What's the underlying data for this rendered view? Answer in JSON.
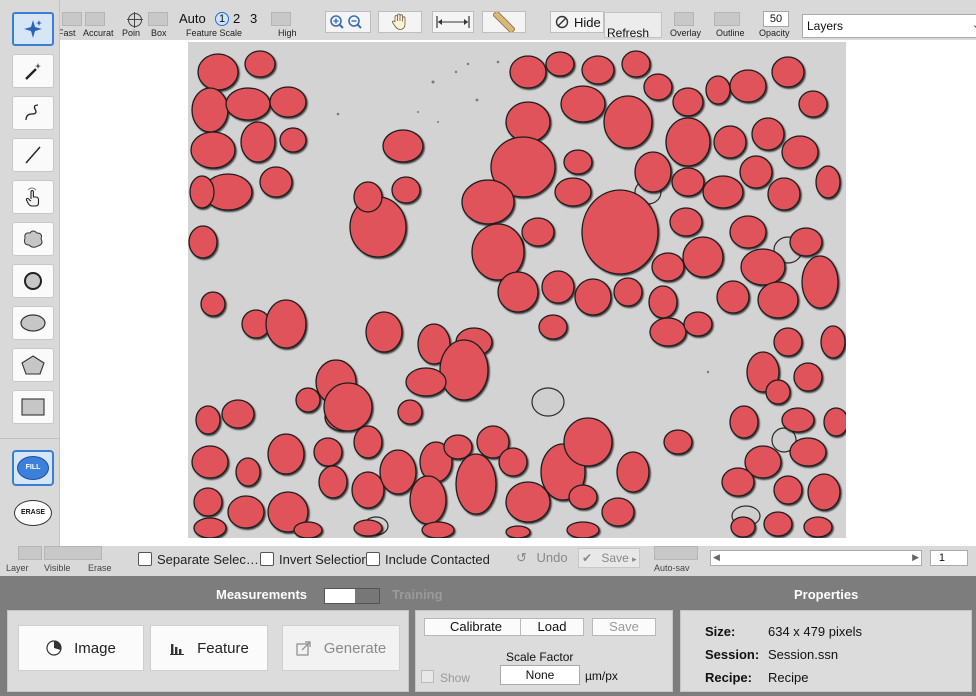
{
  "top_toolbar": {
    "labels": {
      "fast": "Fast",
      "accurate": "Accurat",
      "point": "Poin",
      "box": "Box",
      "feature_scale": "Feature Scale",
      "high": "High",
      "overlay": "Overlay",
      "outline": "Outline",
      "opacity": "Opacity"
    },
    "scale_auto": "Auto",
    "scale_options": [
      "1",
      "2",
      "3"
    ],
    "scale_selected": "1",
    "hide_label": "Hide",
    "refresh_label": "Refresh",
    "opacity_value": "50",
    "layers_value": "Layers"
  },
  "left_tools": {
    "items": [
      "sparkle-select",
      "magic-wand",
      "freehand",
      "line",
      "touch",
      "blob",
      "circle-outline",
      "ellipse",
      "polygon",
      "rectangle"
    ],
    "active": "sparkle-select",
    "fill_label": "FILL",
    "erase_label": "ERASE",
    "fill_active": true
  },
  "image_status": {
    "labels": {
      "layer": "Layer",
      "visible": "Visible",
      "erase": "Erase",
      "autosave": "Auto-sav"
    },
    "separate_selection": "Separate Selec…",
    "invert_selection": "Invert Selectior",
    "include_contacted": "Include Contacted",
    "undo_label": "Undo",
    "save_label": "Save",
    "page_value": "1"
  },
  "bottom": {
    "measurements_tab": "Measurements",
    "training_tab": "Training",
    "buttons": {
      "image": "Image",
      "feature": "Feature",
      "generate": "Generate"
    },
    "calibration": {
      "calibrate": "Calibrate",
      "load": "Load",
      "save": "Save",
      "scale_factor_label": "Scale Factor",
      "scale_factor_value": "None",
      "unit": "µm/px",
      "show_label": "Show"
    },
    "properties": {
      "title": "Properties",
      "size_label": "Size:",
      "size_value": "634 x 479 pixels",
      "session_label": "Session:",
      "session_value": "Session.ssn",
      "recipe_label": "Recipe:",
      "recipe_value": "Recipe"
    }
  },
  "colors": {
    "toolbar_bg": "#d9d9d9",
    "active_border": "#3c7ed2",
    "particle_fill": "#e0535a",
    "bottom_bg": "#7d7d7d"
  }
}
